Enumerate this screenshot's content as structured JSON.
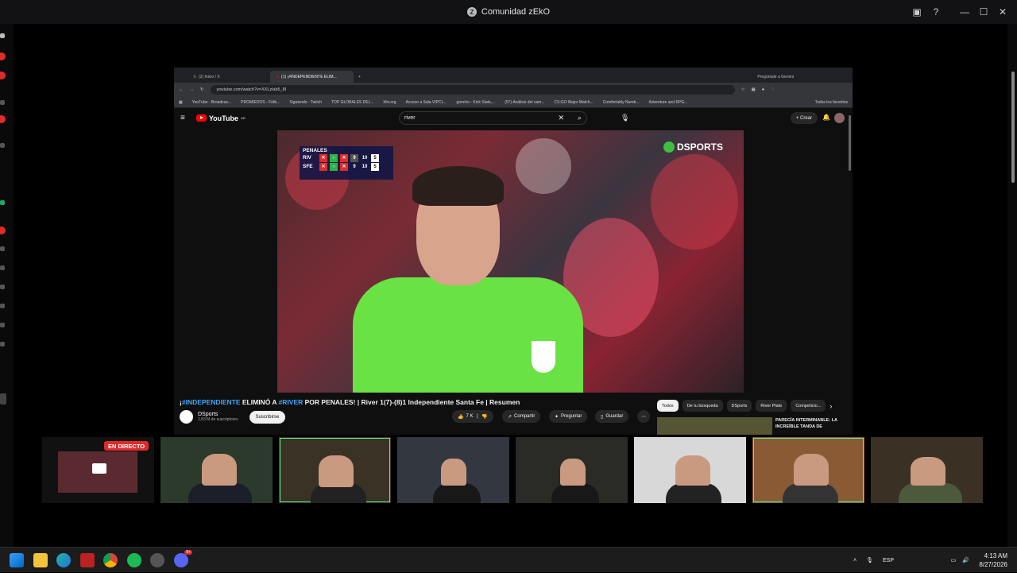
{
  "window": {
    "title": "Comunidad zEkO",
    "app_icon": "Z"
  },
  "browser": {
    "tabs": [
      "(2) Inicio / X",
      "(1) ¡#INDEPENDIENTE ELIM..."
    ],
    "gemini_label": "Pregúntale a Gemini",
    "url": "youtube.com/watch?v=XXLzlab5_8I",
    "bookmarks": [
      "YouTube - Broadcas...",
      "PROMIEDOS - Fútb...",
      "Siguiendo - Twitch",
      "TOP GLOBALES DEL...",
      "hltv.org",
      "Acceso a Sala VIPCL...",
      "goncho - Kick Stats,...",
      "(57) Análisis del cam...",
      "CS:GO Major Match...",
      "Comfortably Numb...",
      "Adventure and RPG..."
    ],
    "all_bookmarks_label": "Todos los favoritos"
  },
  "youtube": {
    "logo_text": "YouTube",
    "logo_country": "AR",
    "search_value": "river",
    "create_label": "Crear",
    "scoreboard": {
      "title": "PENALES",
      "rows": [
        {
          "team": "RIV",
          "marks": [
            "x",
            "o",
            "x"
          ],
          "a": "9",
          "b": "10",
          "score": "5"
        },
        {
          "team": "SFE",
          "marks": [
            "x",
            "o",
            "x"
          ],
          "a": "9",
          "b": "10",
          "score": "5"
        }
      ]
    },
    "broadcaster_logo": "DSPORTS",
    "video_title_prefix": "¡",
    "video_title_tag1": "#INDEPENDIENTE",
    "video_title_mid": " ELIMINÓ A ",
    "video_title_tag2": "#RIVER",
    "video_title_suffix": " POR PENALES! | River 1(7)-(8)1 Independiente Santa Fe | Resumen",
    "channel_name": "DSports",
    "channel_subs": "1,83 M de suscriptores",
    "subscribe_label": "Suscribirse",
    "likes": "7 K",
    "share_label": "Compartir",
    "ask_label": "Preguntar",
    "save_label": "Guardar",
    "chips": [
      "Todos",
      "De tu búsqueda",
      "DSports",
      "River Plate",
      "Competicio..."
    ],
    "suggested_title": "PARECÍA INTERMINABLE: LA INCREÍBLE TANDA DE"
  },
  "stream": {
    "live_label": "EN DIRECTO"
  },
  "taskbar": {
    "lang": "ESP",
    "time": "4:13 AM",
    "date": "8/27/2026",
    "discord_badge": "9+"
  },
  "colors": {
    "accent_green": "#57f287",
    "live_red": "#e02b2b",
    "keeper_green": "#69e244",
    "youtube_red": "#ff0000"
  }
}
